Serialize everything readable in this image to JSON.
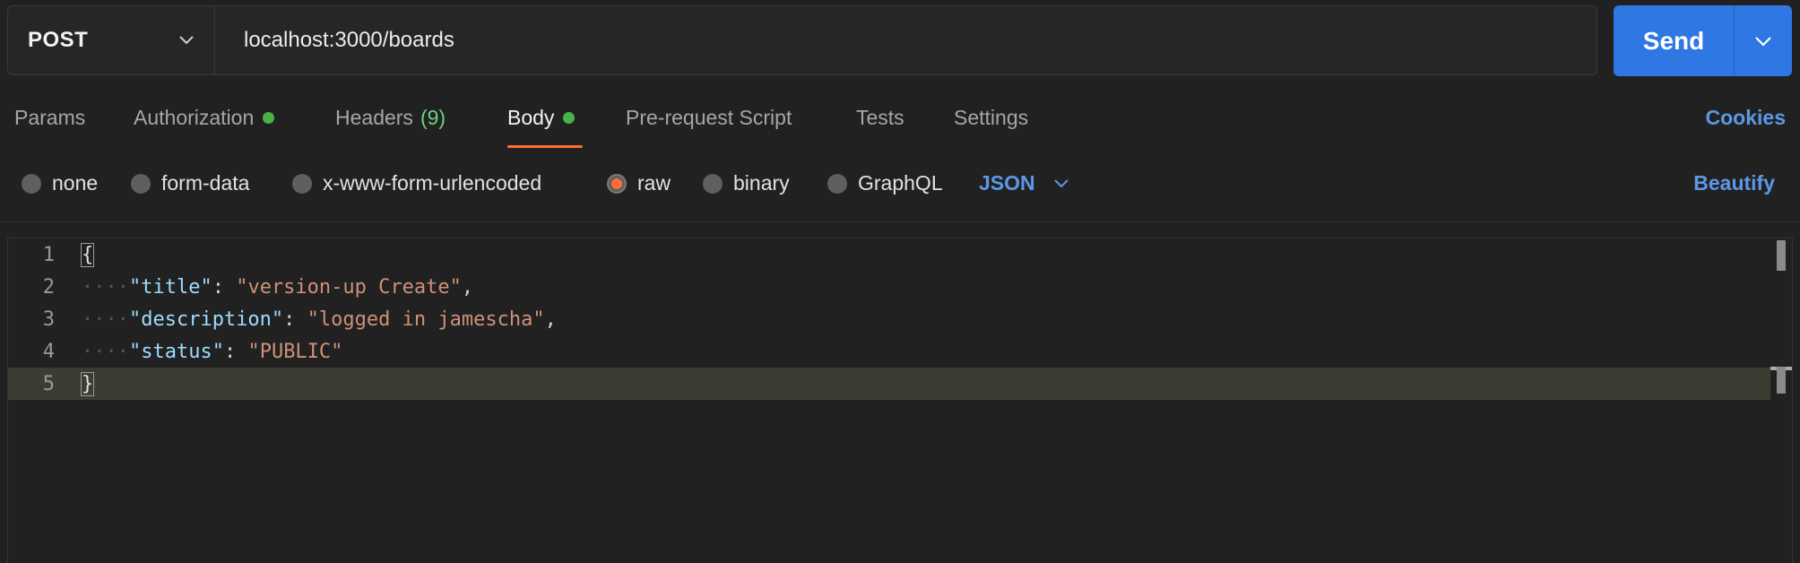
{
  "request": {
    "method": "POST",
    "url": "localhost:3000/boards",
    "send_label": "Send"
  },
  "tabs": [
    {
      "label": "Params"
    },
    {
      "label": "Authorization"
    },
    {
      "label": "Headers",
      "count": "(9)"
    },
    {
      "label": "Body"
    },
    {
      "label": "Pre-request Script"
    },
    {
      "label": "Tests"
    },
    {
      "label": "Settings"
    }
  ],
  "cookies_label": "Cookies",
  "body_types": [
    "none",
    "form-data",
    "x-www-form-urlencoded",
    "raw",
    "binary",
    "GraphQL"
  ],
  "selected_body_type": "raw",
  "raw_format": "JSON",
  "beautify_label": "Beautify",
  "editor": {
    "line_numbers": [
      "1",
      "2",
      "3",
      "4",
      "5"
    ],
    "open_brace": "{",
    "close_brace": "}",
    "fields": [
      {
        "key": "\"title\"",
        "value": "\"version-up Create\"",
        "trail": ","
      },
      {
        "key": "\"description\"",
        "value": "\"logged in jamescha\"",
        "trail": ","
      },
      {
        "key": "\"status\"",
        "value": "\"PUBLIC\"",
        "trail": ""
      }
    ]
  },
  "colors": {
    "accent": "#ff6c37",
    "primary": "#2f77e3",
    "link": "#5c98e6",
    "status_dot": "#4ab24a"
  }
}
